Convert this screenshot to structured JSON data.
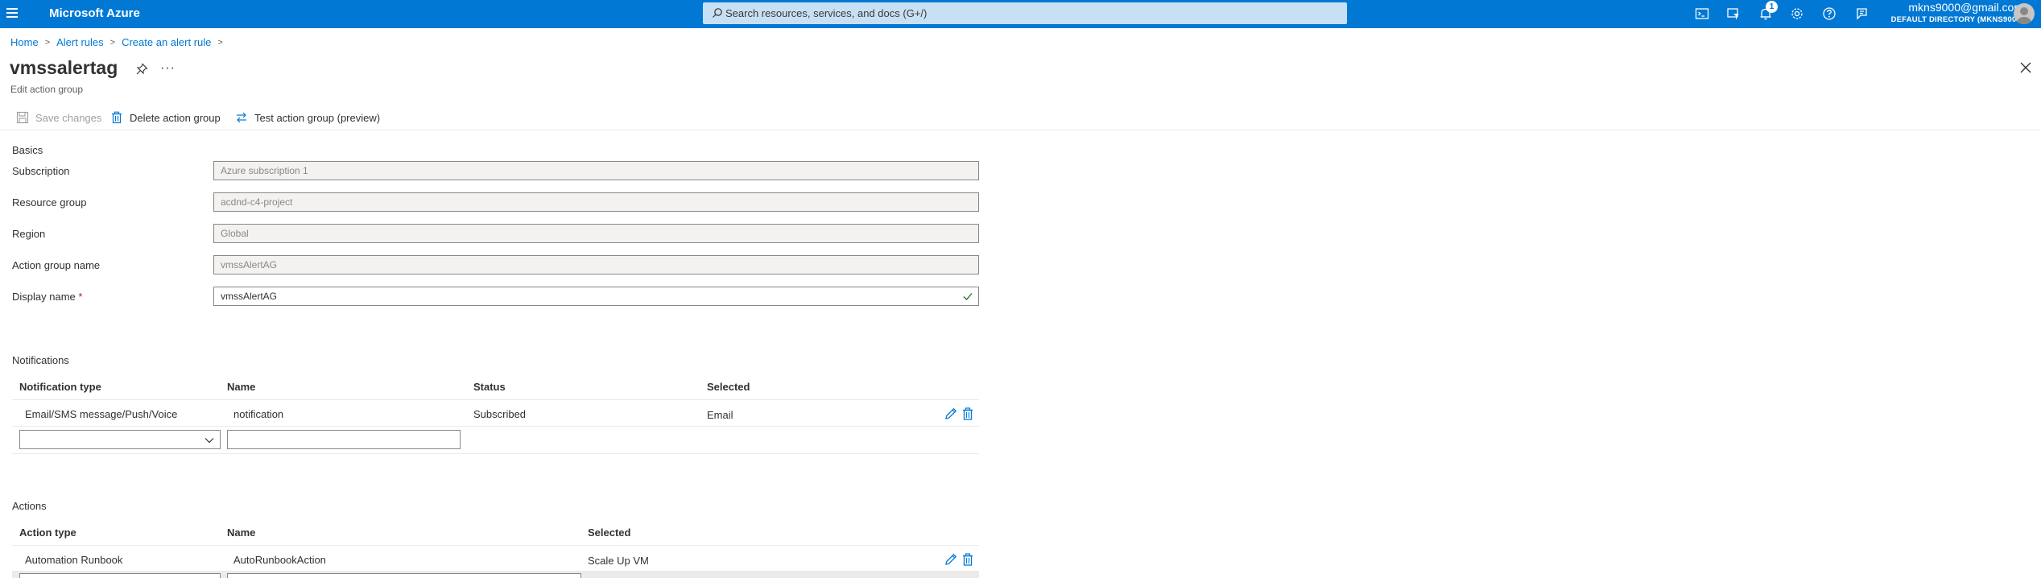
{
  "topbar": {
    "brand": "Microsoft Azure",
    "search_placeholder": "Search resources, services, and docs (G+/)",
    "notification_count": "1",
    "account_email": "mkns9000@gmail.com",
    "account_directory": "DEFAULT DIRECTORY (MKNS900...",
    "icons": [
      "cloud-shell-icon",
      "directory-filter-icon",
      "notifications-icon",
      "settings-icon",
      "help-icon",
      "feedback-icon"
    ],
    "accent_color": "#0078d4"
  },
  "breadcrumb": {
    "items": [
      "Home",
      "Alert rules",
      "Create an alert rule"
    ]
  },
  "page": {
    "title": "vmssalertag",
    "subtitle": "Edit action group"
  },
  "toolbar": {
    "save_label": "Save changes",
    "delete_label": "Delete action group",
    "test_label": "Test action group (preview)"
  },
  "basics": {
    "section_title": "Basics",
    "subscription_label": "Subscription",
    "subscription_value": "Azure subscription 1",
    "resource_group_label": "Resource group",
    "resource_group_value": "acdnd-c4-project",
    "region_label": "Region",
    "region_value": "Global",
    "action_group_name_label": "Action group name",
    "action_group_name_value": "vmssAlertAG",
    "display_name_label": "Display name",
    "display_name_value": "vmssAlertAG"
  },
  "notifications": {
    "section_title": "Notifications",
    "columns": [
      "Notification type",
      "Name",
      "Status",
      "Selected"
    ],
    "rows": [
      {
        "type": "Email/SMS message/Push/Voice",
        "name": "notification",
        "status": "Subscribed",
        "selected": "Email"
      }
    ]
  },
  "actions": {
    "section_title": "Actions",
    "columns": [
      "Action type",
      "Name",
      "Selected"
    ],
    "rows": [
      {
        "type": "Automation Runbook",
        "name": "AutoRunbookAction",
        "selected": "Scale Up VM"
      }
    ]
  }
}
